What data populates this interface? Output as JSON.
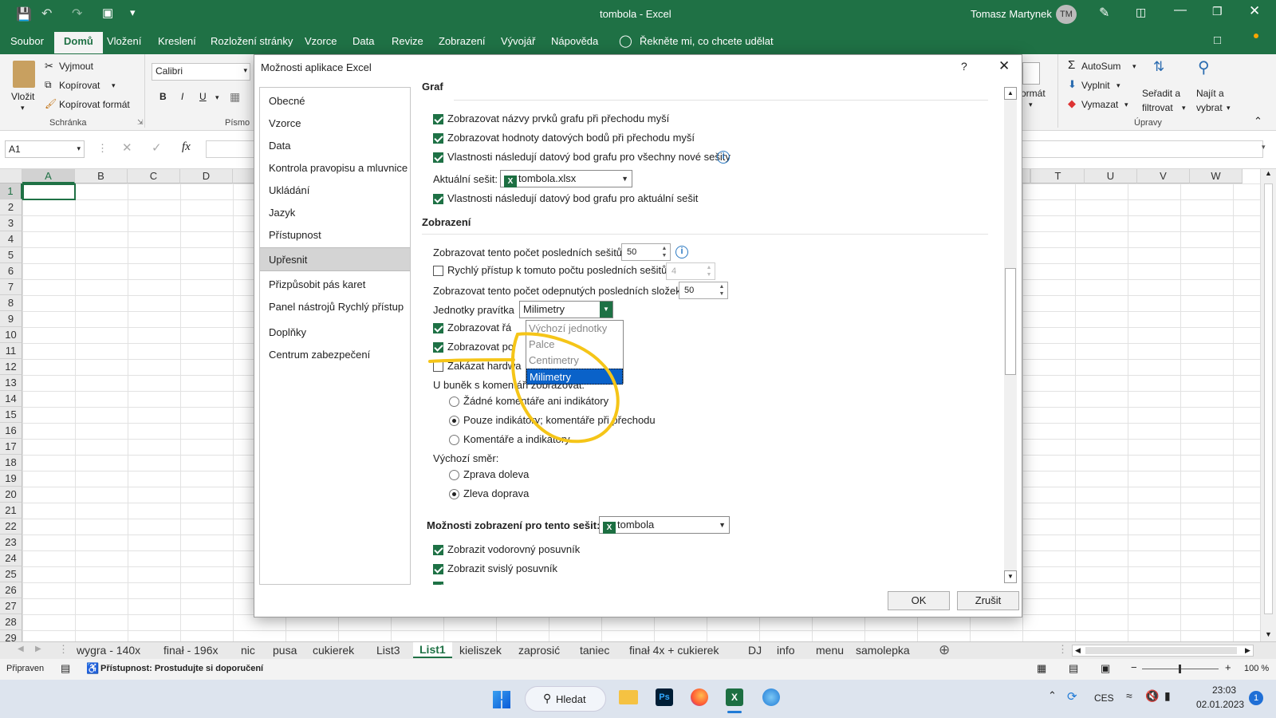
{
  "window": {
    "title": "tombola  -  Excel",
    "user": "Tomasz Martynek",
    "user_initials": "TM"
  },
  "ribbon_tabs": [
    "Soubor",
    "Domů",
    "Vložení",
    "Kreslení",
    "Rozložení stránky",
    "Vzorce",
    "Data",
    "Revize",
    "Zobrazení",
    "Vývojář",
    "Nápověda"
  ],
  "tell_me": "Řekněte mi, co chcete udělat",
  "ribbon": {
    "paste": "Vložit",
    "cut": "Vyjmout",
    "copy": "Kopírovat",
    "format_painter": "Kopírovat formát",
    "group_clipboard": "Schránka",
    "font_name": "Calibri",
    "group_font": "Písmo",
    "bold": "B",
    "italic": "I",
    "underline": "U",
    "format": "ormát",
    "autosum": "AutoSum",
    "fill": "Vyplnit",
    "clear": "Vymazat",
    "sort": "Seřadit a",
    "sort2": "filtrovat",
    "find": "Najít a",
    "find2": "vybrat",
    "group_edit": "Úpravy"
  },
  "formula_bar": {
    "name_box": "A1",
    "fx": "fx"
  },
  "columns_left": [
    "A",
    "B",
    "C",
    "D"
  ],
  "columns_right": [
    "T",
    "U",
    "V",
    "W"
  ],
  "rows": [
    "1",
    "2",
    "3",
    "4",
    "5",
    "6",
    "7",
    "8",
    "9",
    "10",
    "11",
    "12",
    "13",
    "14",
    "15",
    "16",
    "17",
    "18",
    "19",
    "20",
    "21",
    "22",
    "23",
    "24",
    "25",
    "26",
    "27",
    "28",
    "29"
  ],
  "sheet_tabs": [
    "wygra - 140x",
    "finał - 196x",
    "nic",
    "pusa",
    "cukierek",
    "List3",
    "List1",
    "kieliszek",
    "zaprosić",
    "taniec",
    "finał 4x + cukierek",
    "DJ",
    "info",
    "menu",
    "samolepka"
  ],
  "active_sheet": "List1",
  "status": {
    "ready": "Připraven",
    "accessibility": "Přístupnost: Prostudujte si doporučení",
    "zoom": "100 %"
  },
  "taskbar": {
    "search": "Hledat",
    "lang": "CES",
    "time": "23:03",
    "date": "02.01.2023",
    "notif": "1"
  },
  "dialog": {
    "title": "Možnosti aplikace Excel",
    "help": "?",
    "nav": [
      "Obecné",
      "Vzorce",
      "Data",
      "Kontrola pravopisu a mluvnice",
      "Ukládání",
      "Jazyk",
      "Přístupnost",
      "Upřesnit",
      "Přizpůsobit pás karet",
      "Panel nástrojů Rychlý přístup",
      "Doplňky",
      "Centrum zabezpečení"
    ],
    "nav_selected": "Upřesnit",
    "sec_chart": "Graf",
    "chart_opts": [
      {
        "label": "Zobrazovat názvy prvků grafu při přechodu myší",
        "checked": true
      },
      {
        "label": "Zobrazovat hodnoty datových bodů při přechodu myší",
        "checked": true
      },
      {
        "label": "Vlastnosti následují datový bod grafu pro všechny nové sešity",
        "checked": true
      }
    ],
    "current_wb_label": "Aktuální sešit:",
    "current_wb_value": "tombola.xlsx",
    "chart_current_opt": {
      "label": "Vlastnosti následují datový bod grafu pro aktuální sešit",
      "checked": true
    },
    "sec_display": "Zobrazení",
    "recent_wb_label": "Zobrazovat tento počet posledních sešitů:",
    "recent_wb_value": "50",
    "quick_access_label": "Rychlý přístup k tomuto počtu posledních sešitů:",
    "quick_access_value": "4",
    "unpinned_label": "Zobrazovat tento počet odepnutých posledních složek:",
    "unpinned_value": "50",
    "ruler_label": "Jednotky pravítka",
    "ruler_value": "Milimetry",
    "ruler_options": [
      "Výchozí jednotky",
      "Palce",
      "Centimetry",
      "Milimetry"
    ],
    "ruler_selected": "Milimetry",
    "cb_formula": "Zobrazovat řá",
    "cb_status": "Zobrazovat po",
    "cb_hw": "Zakázat hardwa",
    "comments_label": "U buněk s komentáři zobrazovat:",
    "comments_opts": [
      {
        "label": "Žádné komentáře ani indikátory",
        "selected": false
      },
      {
        "label": "Pouze indikátory; komentáře při přechodu",
        "selected": true
      },
      {
        "label": "Komentáře a indikátory",
        "selected": false
      }
    ],
    "direction_label": "Výchozí směr:",
    "direction_opts": [
      {
        "label": "Zprava doleva",
        "selected": false
      },
      {
        "label": "Zleva doprava",
        "selected": true
      }
    ],
    "wb_display_label": "Možnosti zobrazení pro tento sešit:",
    "wb_display_value": "tombola",
    "wb_opts": [
      {
        "label": "Zobrazit vodorovný posuvník",
        "checked": true
      },
      {
        "label": "Zobrazit svislý posuvník",
        "checked": true
      }
    ],
    "ok": "OK",
    "cancel": "Zrušit"
  },
  "colors": {
    "excel_green": "#1f7145",
    "highlight": "#f5c518",
    "selection_blue": "#0a62c9"
  }
}
